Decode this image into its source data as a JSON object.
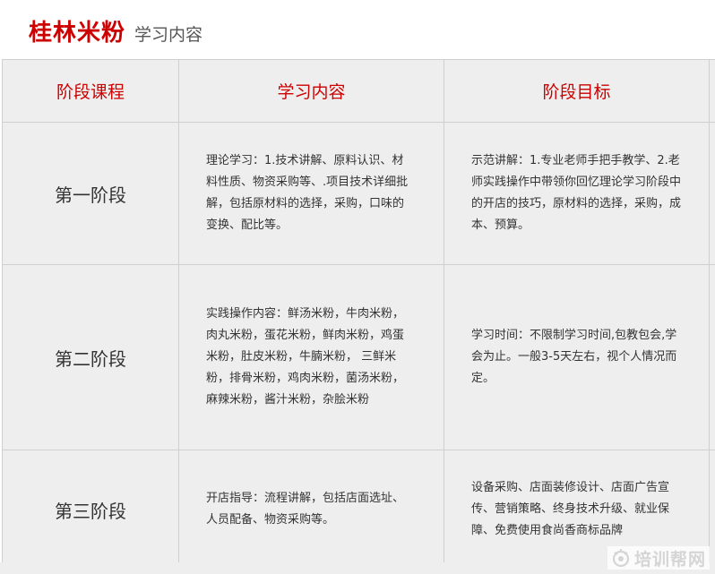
{
  "header": {
    "brand": "桂林米粉",
    "subtitle": "学习内容"
  },
  "table": {
    "headers": [
      "阶段课程",
      "学习内容",
      "阶段目标"
    ],
    "rows": [
      {
        "stage": "第一阶段",
        "content": "理论学习：1.技术讲解、原料认识、材料性质、物资采购等、.项目技术详细批解，包括原材料的选择，采购，口味的变换、配比等。",
        "goal": "示范讲解：1.专业老师手把手教学、2.老师实践操作中带领你回忆理论学习阶段中的开店的技巧，原材料的选择，采购，成本、预算。"
      },
      {
        "stage": "第二阶段",
        "content": "实践操作内容：鲜汤米粉，牛肉米粉，肉丸米粉，蛋花米粉，鲜肉米粉，鸡蛋米粉，肚皮米粉，牛腩米粉， 三鲜米粉，排骨米粉，鸡肉米粉，菌汤米粉，麻辣米粉，酱汁米粉，杂脍米粉",
        "goal": "学习时间：不限制学习时间,包教包会,学会为止。一般3-5天左右，视个人情况而定。"
      },
      {
        "stage": "第三阶段",
        "content": "开店指导：流程讲解，包括店面选址、人员配备、物资采购等。",
        "goal": "设备采购、店面装修设计、店面广告宣传、营销策略、终身技术升级、就业保障、免费使用食尚香商标品牌"
      }
    ]
  },
  "watermark": {
    "text": "培训帮网",
    "logo": "peixunbang-logo"
  },
  "colors": {
    "accent": "#cc0000",
    "table_bg": "#eeeeee",
    "border": "#cfcfcf"
  }
}
